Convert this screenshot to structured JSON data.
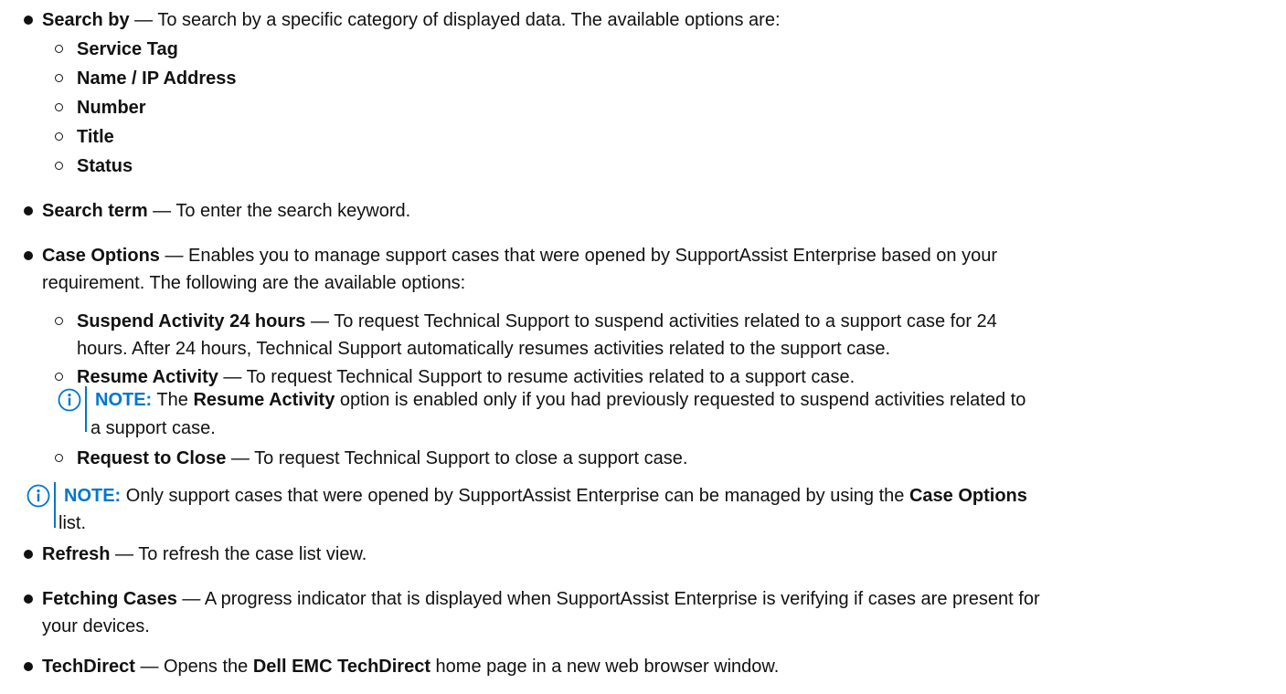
{
  "search_by": {
    "term": "Search by",
    "desc": " — To search by a specific category of displayed data. The available options are:",
    "options": [
      "Service Tag",
      "Name / IP Address",
      "Number",
      "Title",
      "Status"
    ]
  },
  "search_term": {
    "term": "Search term",
    "desc": " — To enter the search keyword."
  },
  "case_options": {
    "term": "Case Options",
    "desc_line1": " — Enables you to manage support cases that were opened by SupportAssist Enterprise based on your",
    "desc_line2": "requirement. The following are the available options:",
    "suspend": {
      "term": "Suspend Activity 24 hours",
      "desc_line1": " — To request Technical Support to suspend activities related to a support case for 24",
      "desc_line2": "hours. After 24 hours, Technical Support automatically resumes activities related to the support case."
    },
    "resume": {
      "term": "Resume Activity",
      "desc": " — To request Technical Support to resume activities related to a support case.",
      "note": {
        "label": "NOTE:",
        "pre": " The ",
        "bold": "Resume Activity",
        "post": " option is enabled only if you had previously requested to suspend activities related to",
        "line2": "a support case."
      }
    },
    "close": {
      "term": "Request to Close",
      "desc": " — To request Technical Support to close a support case."
    },
    "note": {
      "label": "NOTE:",
      "text": " Only support cases that were opened by SupportAssist Enterprise can be managed by using the ",
      "bold": "Case Options",
      "line2": "list."
    }
  },
  "refresh": {
    "term": "Refresh",
    "desc": " — To refresh the case list view."
  },
  "fetching": {
    "term": "Fetching Cases",
    "desc_line1": " — A progress indicator that is displayed when SupportAssist Enterprise is verifying if cases are present for",
    "desc_line2": "your devices."
  },
  "techdirect": {
    "term": "TechDirect",
    "desc_pre": " — Opens the ",
    "bold": "Dell EMC TechDirect",
    "desc_post": " home page in a new web browser window."
  },
  "colors": {
    "text": "#111111",
    "note_accent": "#0076ce"
  },
  "icons": {
    "note": "info-circle-icon",
    "bullet_level1": "filled-circle",
    "bullet_level2": "hollow-circle"
  }
}
